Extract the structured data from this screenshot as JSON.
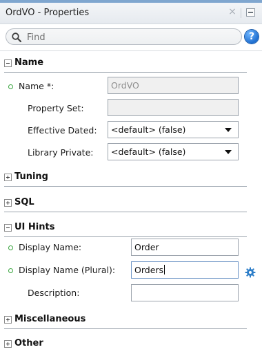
{
  "window": {
    "title": "OrdVO - Properties",
    "close_glyph": "×"
  },
  "search": {
    "placeholder": "Find",
    "value": ""
  },
  "help": {
    "glyph": "?"
  },
  "sections": {
    "name": {
      "label": "Name",
      "expanded": true
    },
    "tuning": {
      "label": "Tuning",
      "expanded": false
    },
    "sql": {
      "label": "SQL",
      "expanded": false
    },
    "ui_hints": {
      "label": "UI Hints",
      "expanded": true
    },
    "misc": {
      "label": "Miscellaneous",
      "expanded": false
    },
    "other": {
      "label": "Other",
      "expanded": false
    }
  },
  "name_section": {
    "name_label": "Name *:",
    "name_value": "OrdVO",
    "property_set_label": "Property Set:",
    "property_set_value": "",
    "effective_dated_label": "Effective Dated:",
    "effective_dated_value": "<default> (false)",
    "library_private_label": "Library Private:",
    "library_private_value": "<default> (false)"
  },
  "ui_hints_section": {
    "display_name_label": "Display Name:",
    "display_name_value": "Order",
    "display_name_plural_label": "Display Name (Plural):",
    "display_name_plural_value": "Orders",
    "description_label": "Description:",
    "description_value": ""
  },
  "colors": {
    "required_dot": "#3aa53f",
    "help_blue": "#1f6fd0",
    "focus_border": "#6d95c6"
  },
  "icons": {
    "required": "required-indicator-icon",
    "edit": "gear-icon",
    "search": "search-icon",
    "help": "help-icon"
  }
}
